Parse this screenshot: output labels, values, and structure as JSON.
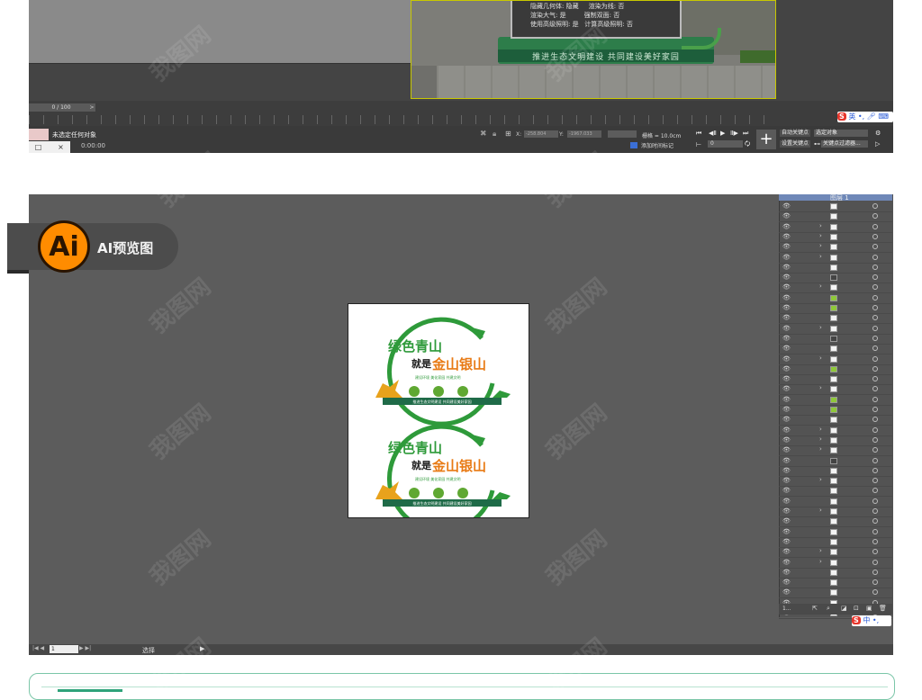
{
  "viewport_3d": {
    "sign_props": [
      {
        "label": "隐藏几何体",
        "value": "隐藏",
        "label2": "渲染为线",
        "value2": "否"
      },
      {
        "label": "渲染大气",
        "value": "是",
        "label2": "强制双面",
        "value2": "否"
      },
      {
        "label": "使用高级照明",
        "value": "是",
        "label2": "计算高级照明",
        "value2": "否"
      }
    ],
    "banner_text": "推进生态文明建设  共同建设美好家园"
  },
  "timeline": {
    "frame": "0 / 100"
  },
  "status_bar": {
    "selection": "未选定任何对象",
    "time": "0:00:00",
    "x_label": "X:",
    "x_value": "-258.804",
    "y_label": "Y:",
    "y_value": "-1967.033",
    "grid": "栅格 = 10.0cm",
    "time_tag": "添加时间标记",
    "frame_spinner": "0",
    "auto_key": "自动关键点",
    "set_key": "设置关键点",
    "selected_object": "选定对象",
    "key_filter": "关键点过滤器...",
    "ime_top": "英",
    "ime_bottom": "中"
  },
  "ai_preview": {
    "logo": "Ai",
    "label": "AI预览图",
    "layer_name": "图层 1",
    "layer_count": "1...",
    "page_field": "1",
    "status": "选择"
  },
  "design": {
    "title_line1": "绿色青山",
    "title_line2_a": "就是",
    "title_line2_b": "金山银山",
    "slogan": "建设环境  美化家园  共建文明",
    "ribbon": "推进生态文明建设  共同建设美好家园"
  },
  "colors": {
    "brand_green": "#2e9a3a",
    "dark_green": "#1f6b48",
    "orange": "#e87a14",
    "ai_orange": "#ff8c00",
    "ai_dark": "#2a1400"
  },
  "watermark": "我图网"
}
